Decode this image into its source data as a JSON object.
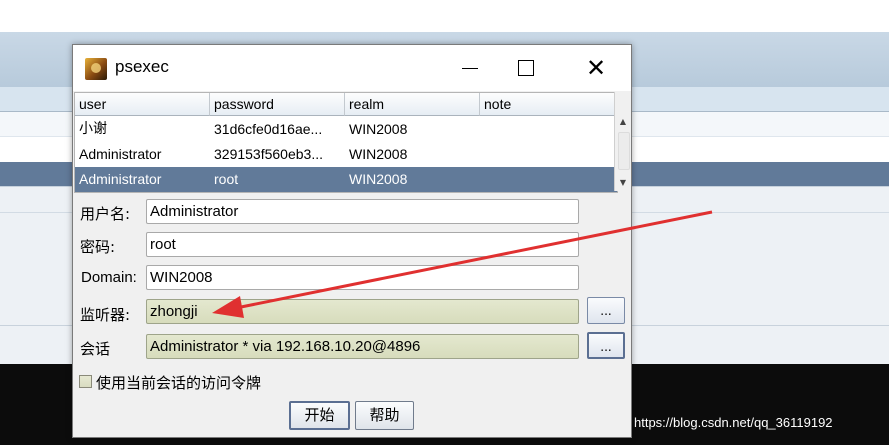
{
  "dialog": {
    "title": "psexec",
    "icon": "app-avatar-icon"
  },
  "table": {
    "columns": [
      "user",
      "password",
      "realm",
      "note"
    ],
    "rows": [
      {
        "user": "小谢",
        "password": "31d6cfe0d16ae...",
        "realm": "WIN2008",
        "note": ""
      },
      {
        "user": "Administrator",
        "password": "329153f560eb3...",
        "realm": "WIN2008",
        "note": ""
      },
      {
        "user": "Administrator",
        "password": "root",
        "realm": "WIN2008",
        "note": ""
      }
    ],
    "selected_row": 2
  },
  "form": {
    "username_label": "用户名:",
    "username_value": "Administrator",
    "password_label": "密码:",
    "password_value": "root",
    "domain_label": "Domain:",
    "domain_value": "WIN2008",
    "listener_label": "监听器:",
    "listener_value": "zhongji",
    "listener_browse": "...",
    "session_label": "会话",
    "session_value": "Administrator * via  192.168.10.20@4896",
    "session_browse": "...",
    "use_token_label": "使用当前会话的访问令牌",
    "use_token_checked": false
  },
  "buttons": {
    "start": "开始",
    "help": "帮助"
  },
  "watermark": "https://blog.csdn.net/qq_36119192",
  "colors": {
    "selection": "#617a99",
    "annotation_arrow": "#e03030"
  }
}
